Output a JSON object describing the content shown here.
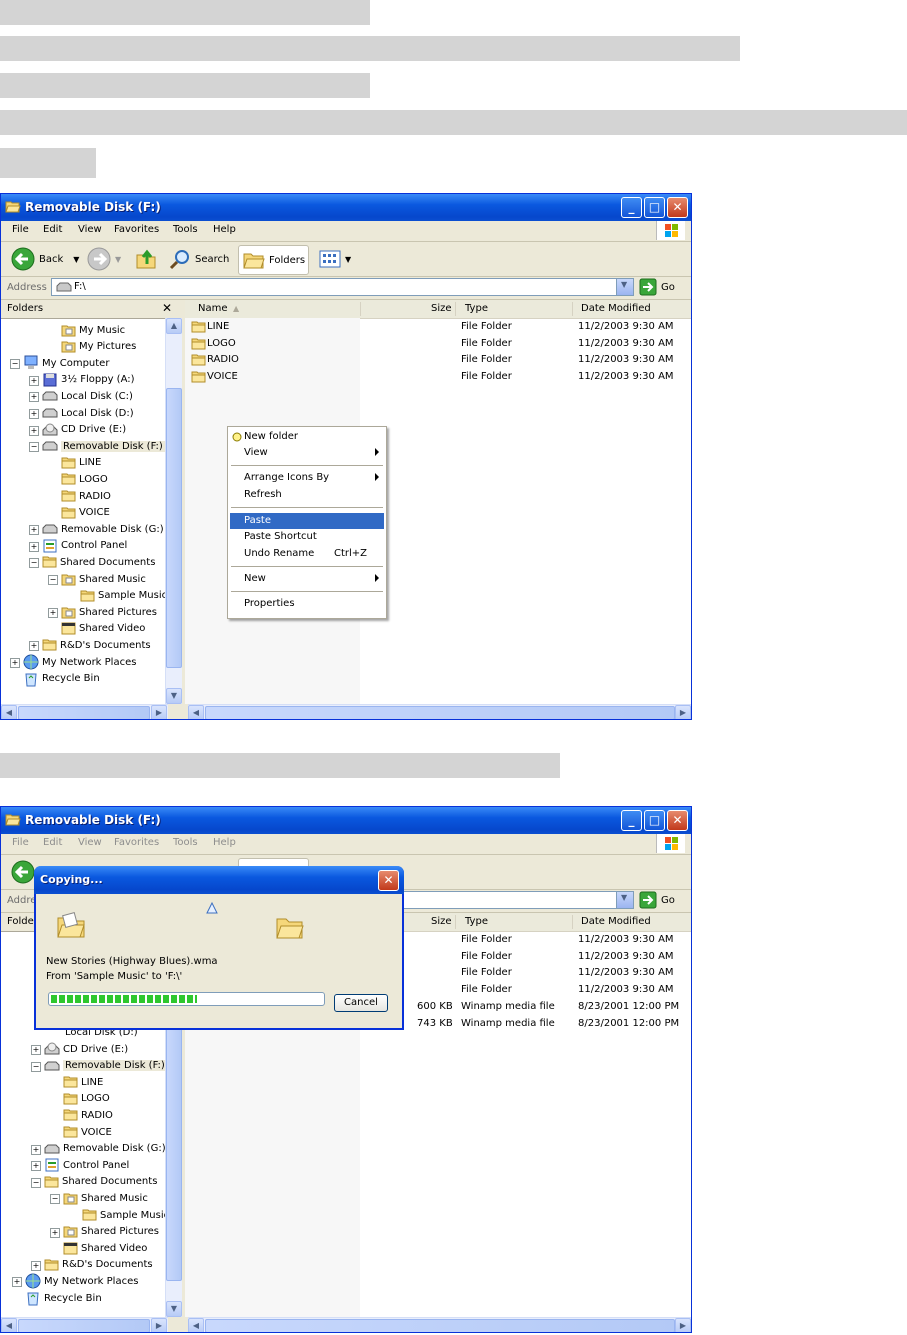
{
  "window": {
    "title": "Removable Disk (F:)",
    "menu": [
      "File",
      "Edit",
      "View",
      "Favorites",
      "Tools",
      "Help"
    ],
    "toolbar": {
      "back": "Back",
      "search": "Search",
      "folders": "Folders"
    },
    "address": {
      "label": "Address",
      "value": "F:\\",
      "go": "Go"
    },
    "folders_pane_title": "Folders",
    "columns": {
      "name": "Name",
      "size": "Size",
      "type": "Type",
      "date": "Date Modified"
    }
  },
  "tree1": [
    {
      "label": "My Music",
      "icon": "music-folder-icon"
    },
    {
      "label": "My Pictures",
      "icon": "pictures-folder-icon"
    },
    {
      "label": "My Computer",
      "icon": "computer-icon"
    },
    {
      "label": "3½ Floppy (A:)",
      "icon": "floppy-icon"
    },
    {
      "label": "Local Disk (C:)",
      "icon": "drive-icon"
    },
    {
      "label": "Local Disk (D:)",
      "icon": "drive-icon"
    },
    {
      "label": "CD Drive (E:)",
      "icon": "cd-drive-icon"
    },
    {
      "label": "Removable Disk (F:)",
      "icon": "drive-icon"
    },
    {
      "label": "LINE",
      "icon": "folder-icon"
    },
    {
      "label": "LOGO",
      "icon": "folder-icon"
    },
    {
      "label": "RADIO",
      "icon": "folder-icon"
    },
    {
      "label": "VOICE",
      "icon": "folder-icon"
    },
    {
      "label": "Removable Disk (G:)",
      "icon": "drive-icon"
    },
    {
      "label": "Control Panel",
      "icon": "control-panel-icon"
    },
    {
      "label": "Shared Documents",
      "icon": "folder-icon"
    },
    {
      "label": "Shared Music",
      "icon": "music-folder-icon"
    },
    {
      "label": "Sample Music",
      "icon": "folder-icon"
    },
    {
      "label": "Shared Pictures",
      "icon": "pictures-folder-icon"
    },
    {
      "label": "Shared Video",
      "icon": "video-folder-icon"
    },
    {
      "label": "R&D's Documents",
      "icon": "folder-icon"
    },
    {
      "label": "My Network Places",
      "icon": "network-icon"
    },
    {
      "label": "Recycle Bin",
      "icon": "recycle-bin-icon"
    }
  ],
  "tree2": [
    {
      "label": "CD Drive (E:)"
    },
    {
      "label": "Removable Disk (F:)"
    },
    {
      "label": "LINE"
    },
    {
      "label": "LOGO"
    },
    {
      "label": "RADIO"
    },
    {
      "label": "VOICE"
    },
    {
      "label": "Removable Disk (G:)"
    },
    {
      "label": "Control Panel"
    },
    {
      "label": "Shared Documents"
    },
    {
      "label": "Shared Music"
    },
    {
      "label": "Sample Music"
    },
    {
      "label": "Shared Pictures"
    },
    {
      "label": "Shared Video"
    },
    {
      "label": "R&D's Documents"
    },
    {
      "label": "My Network Places"
    },
    {
      "label": "Recycle Bin"
    }
  ],
  "partial_tree2": {
    "folders": "Folde",
    "address": "Addre",
    "local_disk_d": "Local Disk (D:)"
  },
  "files1": [
    {
      "name": "LINE",
      "size": "",
      "type": "File Folder",
      "date": "11/2/2003 9:30 AM"
    },
    {
      "name": "LOGO",
      "size": "",
      "type": "File Folder",
      "date": "11/2/2003 9:30 AM"
    },
    {
      "name": "RADIO",
      "size": "",
      "type": "File Folder",
      "date": "11/2/2003 9:30 AM"
    },
    {
      "name": "VOICE",
      "size": "",
      "type": "File Folder",
      "date": "11/2/2003 9:30 AM"
    }
  ],
  "files2": [
    {
      "name": "",
      "size": "",
      "type": "File Folder",
      "date": "11/2/2003 9:30 AM"
    },
    {
      "name": "",
      "size": "",
      "type": "File Folder",
      "date": "11/2/2003 9:30 AM"
    },
    {
      "name": "",
      "size": "",
      "type": "File Folder",
      "date": "11/2/2003 9:30 AM"
    },
    {
      "name": "",
      "size": "",
      "type": "File Folder",
      "date": "11/2/2003 9:30 AM"
    },
    {
      "name": "",
      "size": "600 KB",
      "type": "Winamp media file",
      "date": "8/23/2001 12:00 PM"
    },
    {
      "name": "New Stories (Highway Blues).m",
      "size": "743 KB",
      "type": "Winamp media file",
      "date": "8/23/2001 12:00 PM"
    }
  ],
  "context_menu": {
    "new_folder": "New folder",
    "view": "View",
    "arrange": "Arrange Icons By",
    "refresh": "Refresh",
    "paste": "Paste",
    "paste_shortcut": "Paste Shortcut",
    "undo_rename": "Undo Rename",
    "undo_shortcut": "Ctrl+Z",
    "new": "New",
    "properties": "Properties"
  },
  "copy_dialog": {
    "title": "Copying...",
    "file": "New Stories (Highway Blues).wma",
    "from_to": "From 'Sample Music' to 'F:\\'",
    "cancel": "Cancel",
    "progress": 0.54
  },
  "colors": {
    "titlebar": "#0a58df",
    "highlight": "#316ac5",
    "progress": "#2ec72e"
  }
}
